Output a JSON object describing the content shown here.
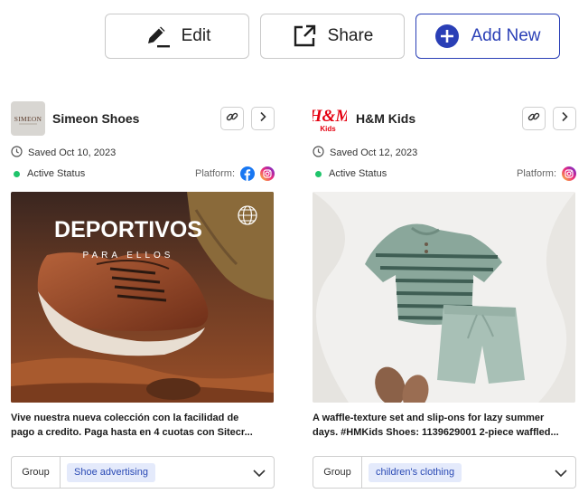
{
  "toolbar": {
    "edit_label": "Edit",
    "share_label": "Share",
    "add_label": "Add New",
    "accent": "#2a3fb6"
  },
  "cards": [
    {
      "brand": "Simeon Shoes",
      "logo_text": "SIMEON",
      "saved": "Saved Oct 10, 2023",
      "status": "Active Status",
      "platform_label": "Platform:",
      "platforms": [
        "facebook-icon",
        "instagram-icon"
      ],
      "image_headline": "DEPORTIVOS",
      "image_subline": "PARA ELLOS",
      "caption_line1": "Vive nuestra nueva colección con la facilidad de",
      "caption_line2": "pago a credito. Paga hasta en 4 cuotas con Sitecr...",
      "group_label": "Group",
      "group_value": "Shoe advertising"
    },
    {
      "brand": "H&M Kids",
      "logo_text": "H&M",
      "logo_sub": "Kids",
      "saved": "Saved Oct 12, 2023",
      "status": "Active Status",
      "platform_label": "Platform:",
      "platforms": [
        "instagram-icon"
      ],
      "caption_line1": "A waffle-texture set and slip-ons for lazy summer",
      "caption_line2": "days. #HMKids Shoes: 1139629001 2-piece waffled...",
      "group_label": "Group",
      "group_value": "children's clothing"
    }
  ],
  "colors": {
    "status_active": "#1fc46b",
    "chip_bg": "#e4eafb",
    "chip_text": "#2b4bb5",
    "hm_red": "#e50010"
  }
}
